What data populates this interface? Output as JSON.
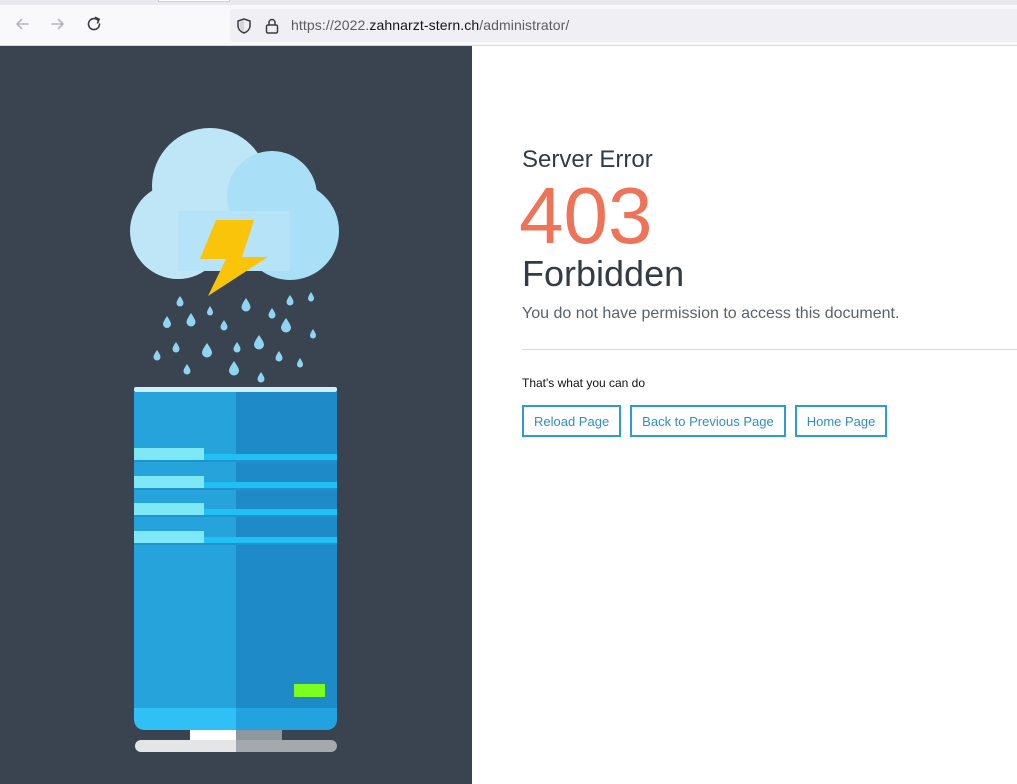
{
  "browser": {
    "url_prefix": "https://2022.",
    "url_host": "zahnarzt-stern.ch",
    "url_path": "/administrator/",
    "icons": [
      "back-arrow-icon",
      "forward-arrow-icon",
      "reload-icon",
      "shield-icon",
      "lock-icon"
    ]
  },
  "error": {
    "heading": "Server Error",
    "code": "403",
    "title": "Forbidden",
    "message": "You do not have permission to access this document."
  },
  "options": {
    "label": "That's what you can do",
    "buttons": [
      "Reload Page",
      "Back to Previous Page",
      "Home Page"
    ]
  },
  "colors": {
    "panel": "#3a4350",
    "code": "#ed7458",
    "button_border": "#2f9bcf",
    "cloud": "#bfe6f7",
    "lightning": "#f9c40a",
    "server": "#27a3dc",
    "led": "#7cff1f"
  }
}
